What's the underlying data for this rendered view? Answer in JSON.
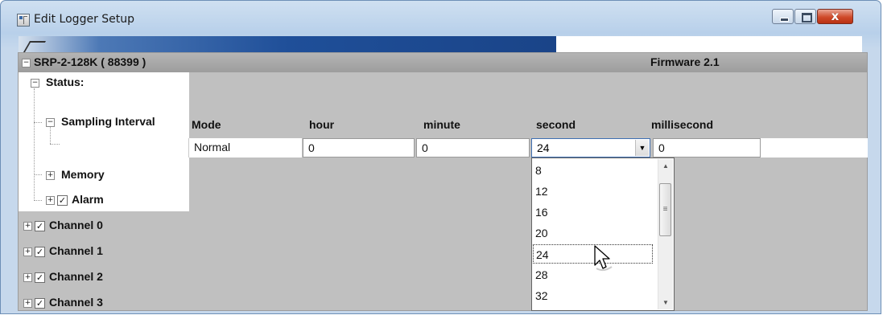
{
  "window": {
    "title": "Edit Logger Setup",
    "minimize_icon": "minimize-icon",
    "maximize_icon": "maximize-icon",
    "close_glyph": "x"
  },
  "device": {
    "name": "SRP-2-128K ( 88399 )",
    "firmware": "Firmware 2.1",
    "expander": "−"
  },
  "tree": {
    "status_label": "Status:",
    "sampling_label": "Sampling Interval",
    "memory_label": "Memory",
    "alarm_label": "Alarm",
    "channels": [
      "Channel 0",
      "Channel 1",
      "Channel 2",
      "Channel 3"
    ],
    "expand_glyph": "+",
    "collapse_glyph": "−",
    "check_glyph": "✓"
  },
  "sampling": {
    "headers": {
      "mode": "Mode",
      "hour": "hour",
      "minute": "minute",
      "second": "second",
      "millisecond": "millisecond"
    },
    "values": {
      "mode": "Normal",
      "hour": "0",
      "minute": "0",
      "second": "24",
      "millisecond": "0"
    }
  },
  "dropdown": {
    "options": [
      "8",
      "12",
      "16",
      "20",
      "24",
      "28",
      "32"
    ],
    "selected": "24"
  },
  "colors": {
    "titlebar": "#c6d8ec",
    "grid_background": "#c0c0c0",
    "device_row": "#a8a8a8",
    "close_button": "#cf4a2a"
  }
}
